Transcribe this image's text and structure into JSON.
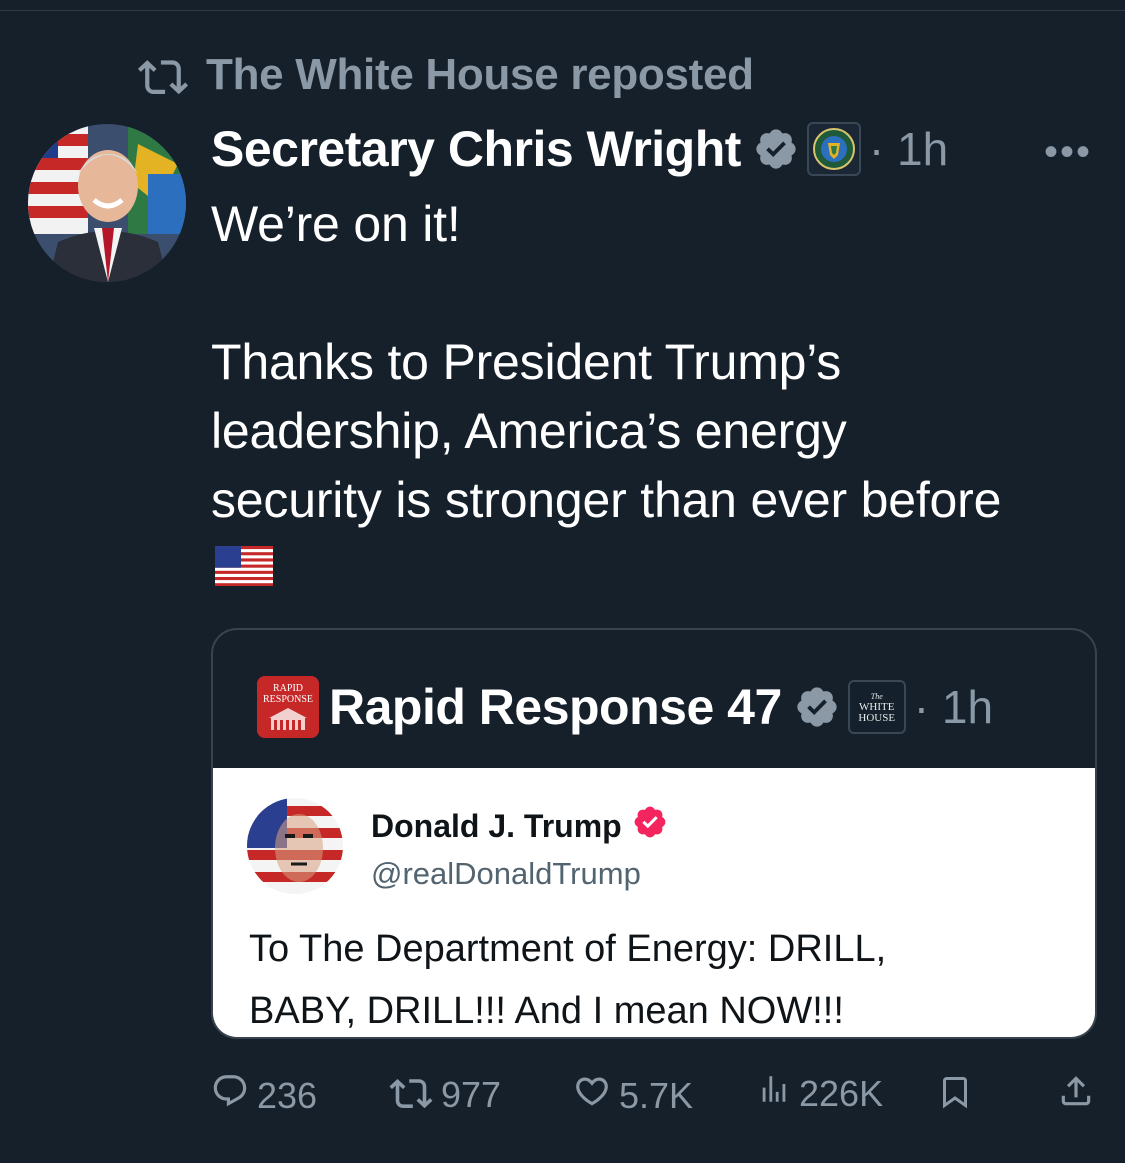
{
  "repost": {
    "label": "The White House reposted",
    "icon": "repost-icon"
  },
  "author": {
    "name": "Secretary Chris Wright",
    "verified_color": "#8b98a5",
    "time": "· 1h"
  },
  "more_label": "•••",
  "tweet": {
    "line1": "We’re on it!",
    "para": [
      "Thanks to President Trump’s",
      "leadership, America’s energy",
      "security is stronger than ever before"
    ],
    "emoji": "flag-us"
  },
  "quote": {
    "avatar_text": [
      "RAPID",
      "RESPONSE"
    ],
    "name": "Rapid Response 47",
    "affil_text": [
      "The",
      "WHITE",
      "HOUSE"
    ],
    "time": "· 1h",
    "image": {
      "name": "Donald J. Trump",
      "verified_color": "#f4245e",
      "handle": "@realDonaldTrump",
      "text_line1": "To The Department of Energy: DRILL,",
      "text_line2": "BABY, DRILL!!!  And I mean NOW!!!"
    }
  },
  "actions": {
    "replies": "236",
    "reposts": "977",
    "likes": "5.7K",
    "views": "226K"
  },
  "colors": {
    "background": "#15202b",
    "muted": "#8b98a5",
    "text": "#e7e9ea"
  }
}
